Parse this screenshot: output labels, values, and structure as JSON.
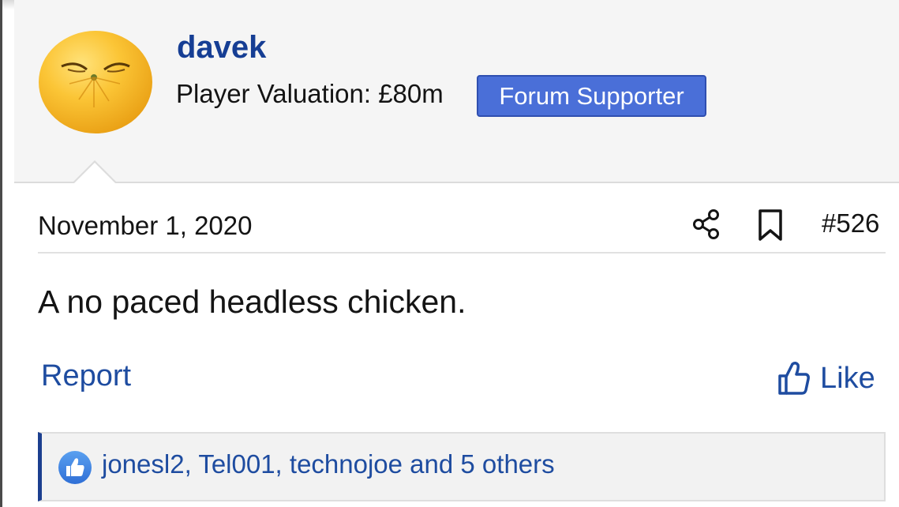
{
  "post": {
    "author": {
      "username": "davek",
      "valuation_text": "Player Valuation: £80m",
      "badge": "Forum Supporter",
      "avatar_icon": "orange-face-avatar"
    },
    "date": "November 1, 2020",
    "number": "#526",
    "body": "A no paced headless chicken.",
    "actions": {
      "report_label": "Report",
      "like_label": "Like",
      "share_icon": "share-icon",
      "bookmark_icon": "bookmark-icon"
    },
    "reactions": {
      "icon": "thumbs-up-reaction-icon",
      "text": "jonesl2, Tel001, technojoe and 5 others"
    }
  },
  "colors": {
    "link": "#1e4ca0",
    "username": "#163e94",
    "badge_bg": "#4a6fd8",
    "header_bg": "#f5f5f5",
    "reaction_bar_accent": "#1c3f8f"
  }
}
